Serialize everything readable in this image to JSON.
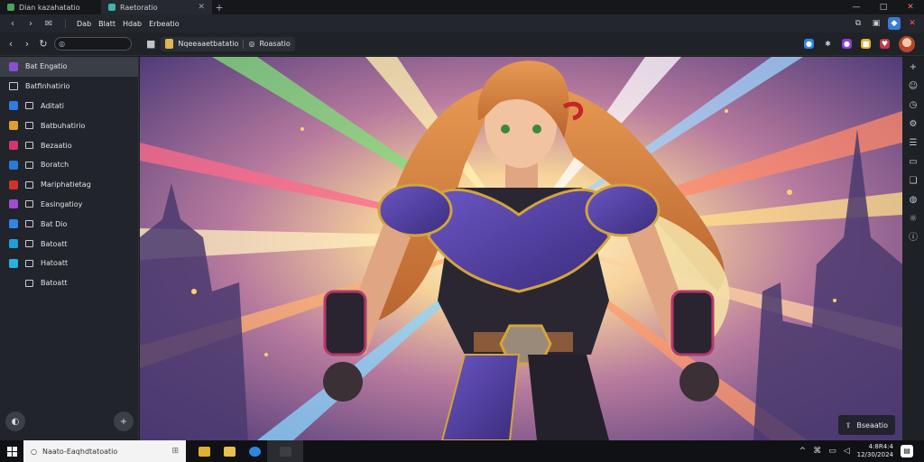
{
  "window": {
    "tabs": [
      {
        "label": "Dian kazahatatio"
      },
      {
        "label": "Raetoratio"
      }
    ],
    "controls": {
      "minimize": "—",
      "maximize": "□",
      "close": "✕"
    }
  },
  "menubar": {
    "items": [
      "Dab",
      "Blatt",
      "Hdab",
      "Erbeatio"
    ]
  },
  "toolbar": {
    "address": "",
    "breadcrumb": {
      "file": "Nqeeaaetbatatio",
      "view": "Roasatio"
    }
  },
  "sidebar": {
    "items": [
      {
        "label": "Bat Engatio",
        "icon": "purple-app-icon",
        "color": "#8a4fd0",
        "active": true
      },
      {
        "label": "Batfinhatirio",
        "icon": "window-icon",
        "color": "",
        "active": false
      },
      {
        "label": "Aditati",
        "icon": "blue-app-icon",
        "color": "#2f7de0",
        "active": false
      },
      {
        "label": "Batbuhatirio",
        "icon": "orange-app-icon",
        "color": "#e0a030",
        "active": false
      },
      {
        "label": "Bezaatio",
        "icon": "pink-app-icon",
        "color": "#d2356e",
        "active": false
      },
      {
        "label": "Boratch",
        "icon": "blue-app-icon",
        "color": "#2a7ad8",
        "active": false
      },
      {
        "label": "Mariphatietag",
        "icon": "red-app-icon",
        "color": "#d0322e",
        "active": false
      },
      {
        "label": "Easingatioy",
        "icon": "purple-app-icon",
        "color": "#a24ad0",
        "active": false
      },
      {
        "label": "Bat Dio",
        "icon": "blue-app-icon",
        "color": "#2f85e8",
        "active": false
      },
      {
        "label": "Batoatt",
        "icon": "teal-app-icon",
        "color": "#1f9fd8",
        "active": false
      },
      {
        "label": "Hatoatt",
        "icon": "cyan-app-icon",
        "color": "#26b3e0",
        "active": false
      },
      {
        "label": "Batoatt",
        "icon": "",
        "color": "",
        "active": false
      }
    ],
    "bottom": {
      "left": "◐",
      "right": "+"
    }
  },
  "main": {
    "float_button": "Bseaatio"
  },
  "taskbar": {
    "search_placeholder": "Naato-Eaqhdtatoatio",
    "clock_time": "4:8R4:4",
    "clock_date": "12/30/2024"
  },
  "colors": {
    "accent": "#3a3e46",
    "hair": "#c9773a",
    "armor": "#5a3f9e",
    "gold": "#d2a43c",
    "sky": "#6a4f9a"
  }
}
